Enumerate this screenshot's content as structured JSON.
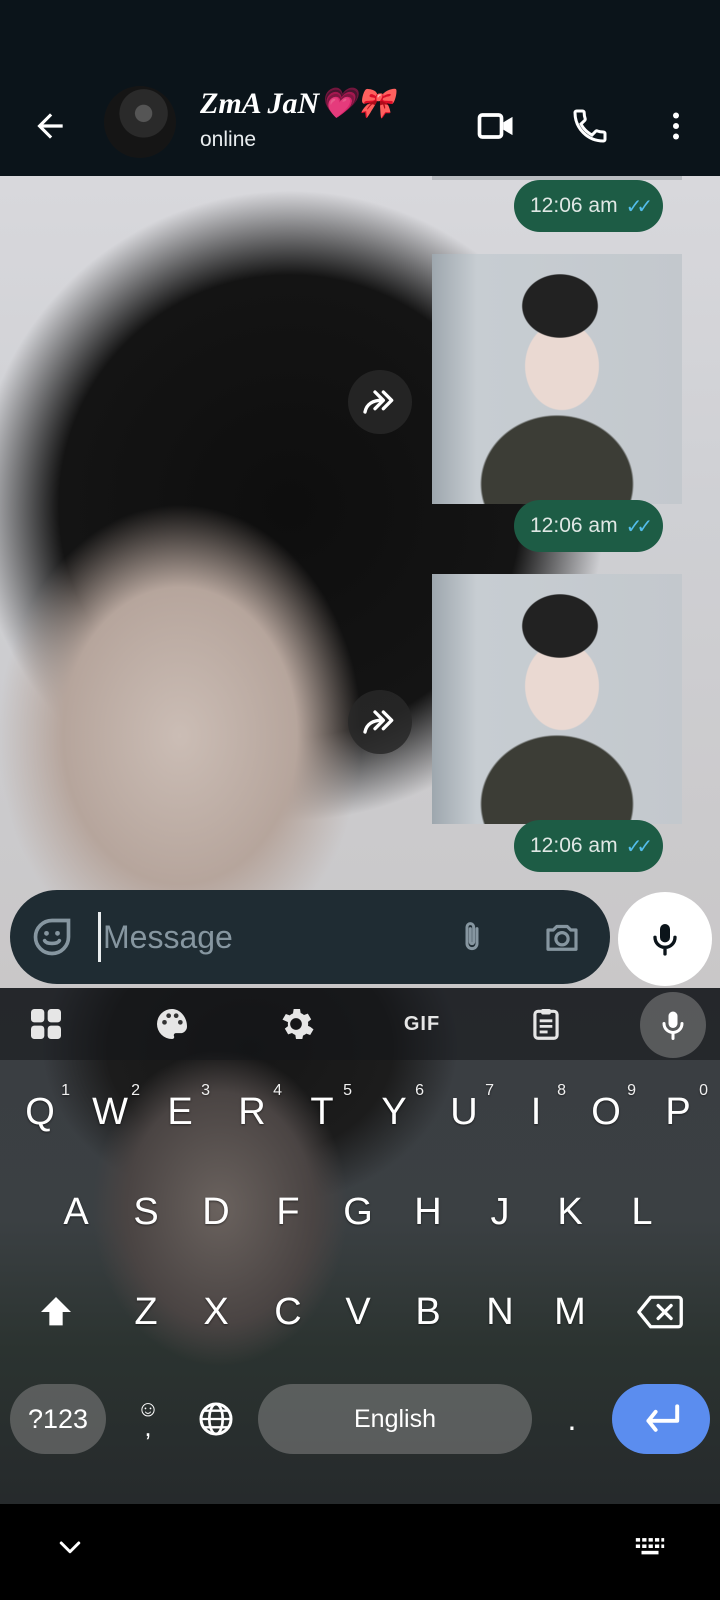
{
  "header": {
    "contact_name": "ZmA JaN💗🎀",
    "status": "online"
  },
  "messages": [
    {
      "type": "image-tail",
      "time": "12:06 am",
      "ticks": "✓✓"
    },
    {
      "type": "image",
      "time": "12:06 am",
      "ticks": "✓✓"
    },
    {
      "type": "image",
      "time": "12:06 am",
      "ticks": "✓✓"
    }
  ],
  "composer": {
    "placeholder": "Message"
  },
  "keyboard": {
    "toolbar": {
      "gif_label": "GIF"
    },
    "row1": [
      {
        "key": "Q",
        "sup": "1"
      },
      {
        "key": "W",
        "sup": "2"
      },
      {
        "key": "E",
        "sup": "3"
      },
      {
        "key": "R",
        "sup": "4"
      },
      {
        "key": "T",
        "sup": "5"
      },
      {
        "key": "Y",
        "sup": "6"
      },
      {
        "key": "U",
        "sup": "7"
      },
      {
        "key": "I",
        "sup": "8"
      },
      {
        "key": "O",
        "sup": "9"
      },
      {
        "key": "P",
        "sup": "0"
      }
    ],
    "row2": [
      "A",
      "S",
      "D",
      "F",
      "G",
      "H",
      "J",
      "K",
      "L"
    ],
    "row3": [
      "Z",
      "X",
      "C",
      "V",
      "B",
      "N",
      "M"
    ],
    "symbols_label": "?123",
    "comma_label": ",",
    "space_label": "English",
    "period_label": "."
  },
  "colors": {
    "bubble": "#1d5c45",
    "ticks": "#53bdeb",
    "enter_key": "#5b8def"
  }
}
